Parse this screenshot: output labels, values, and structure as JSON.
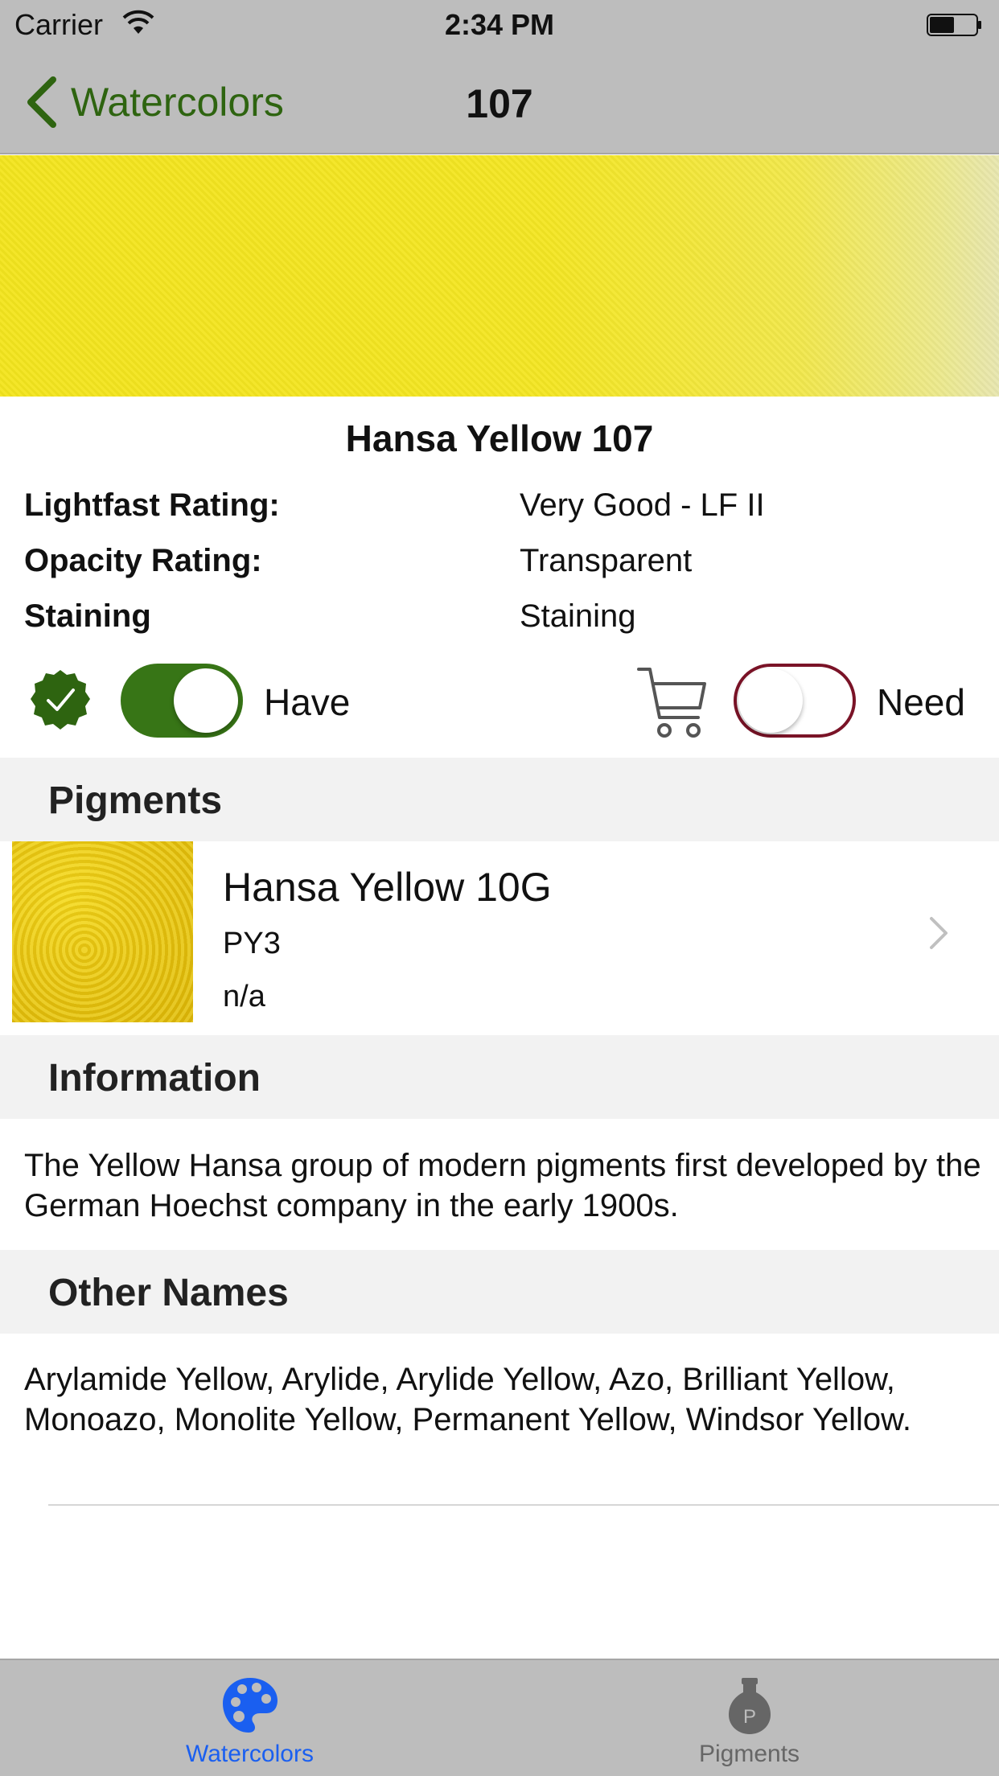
{
  "status_bar": {
    "carrier": "Carrier",
    "time": "2:34 PM"
  },
  "nav": {
    "back_label": "Watercolors",
    "title": "107"
  },
  "paint": {
    "name": "Hansa Yellow 107",
    "swatch_color": "#f3e51e",
    "properties": [
      {
        "label": "Lightfast Rating:",
        "value": "Very Good - LF II"
      },
      {
        "label": "Opacity Rating:",
        "value": "Transparent"
      },
      {
        "label": "Staining",
        "value": "Staining"
      }
    ]
  },
  "toggles": {
    "have": {
      "label": "Have",
      "on": true,
      "color": "#377516"
    },
    "need": {
      "label": "Need",
      "on": false,
      "color": "#7a1327"
    }
  },
  "sections": {
    "pigments": {
      "header": "Pigments"
    },
    "information": {
      "header": "Information",
      "text": "The Yellow Hansa group of modern pigments first developed by the German Hoechst company in the early 1900s."
    },
    "other_names": {
      "header": "Other Names",
      "text": "Arylamide Yellow, Arylide, Arylide Yellow, Azo, Brilliant Yellow, Monoazo, Monolite Yellow, Permanent Yellow, Windsor Yellow."
    }
  },
  "pigments": [
    {
      "name": "Hansa Yellow 10G",
      "code": "PY3",
      "extra": "n/a"
    }
  ],
  "tabs": [
    {
      "label": "Watercolors",
      "icon": "palette-icon",
      "selected": true,
      "color": "#1a5ff0"
    },
    {
      "label": "Pigments",
      "icon": "pigment-jar-icon",
      "selected": false,
      "color": "#666666"
    }
  ]
}
